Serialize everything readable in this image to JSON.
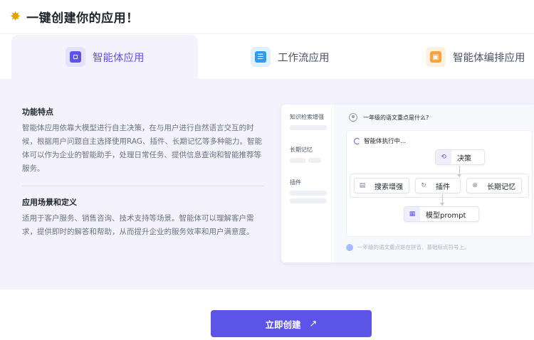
{
  "header": {
    "title": "一键创建你的应用！",
    "icon": "sparkle-icon"
  },
  "tabs": [
    {
      "label": "智能体应用",
      "active": true,
      "icon": "agent-app-icon",
      "color": "#5b54e6"
    },
    {
      "label": "工作流应用",
      "active": false,
      "icon": "workflow-app-icon",
      "color": "#2e9bf0"
    },
    {
      "label": "智能体编排应用",
      "active": false,
      "icon": "agent-orchestration-icon",
      "color": "#f5a33a"
    }
  ],
  "features": {
    "title": "功能特点",
    "body": "智能体应用依靠大模型进行自主决策，在与用户进行自然语言交互的时候，根据用户问题自主选择使用RAG、插件、长期记忆等多种能力。智能体可以作为企业的智能助手，处理日常任务、提供信息查询和智能推荐等服务。"
  },
  "scenarios": {
    "title": "应用场景和定义",
    "body": "适用于客户服务、销售咨询、技术支持等场景。智能体可以理解客户需求，提供即时的解答和帮助，从而提升企业的服务效率和用户满意度。"
  },
  "preview": {
    "sidebar": [
      "知识检索增强",
      "长期记忆",
      "插件"
    ],
    "question": "一年级的语文重点是什么?",
    "status": "智能体执行中...",
    "nodes": {
      "decision": "决策",
      "search": "搜索增强",
      "plugin": "插件",
      "memory": "长期记忆",
      "model": "模型prompt"
    },
    "input_hint": "一年级的语文重点是在拼音、基础标点符号上。"
  },
  "cta": {
    "label": "立即创建",
    "icon": "arrow-up-right-icon"
  },
  "colors": {
    "accent": "#5b54e6",
    "panel_bg": "#f4f3fd"
  }
}
